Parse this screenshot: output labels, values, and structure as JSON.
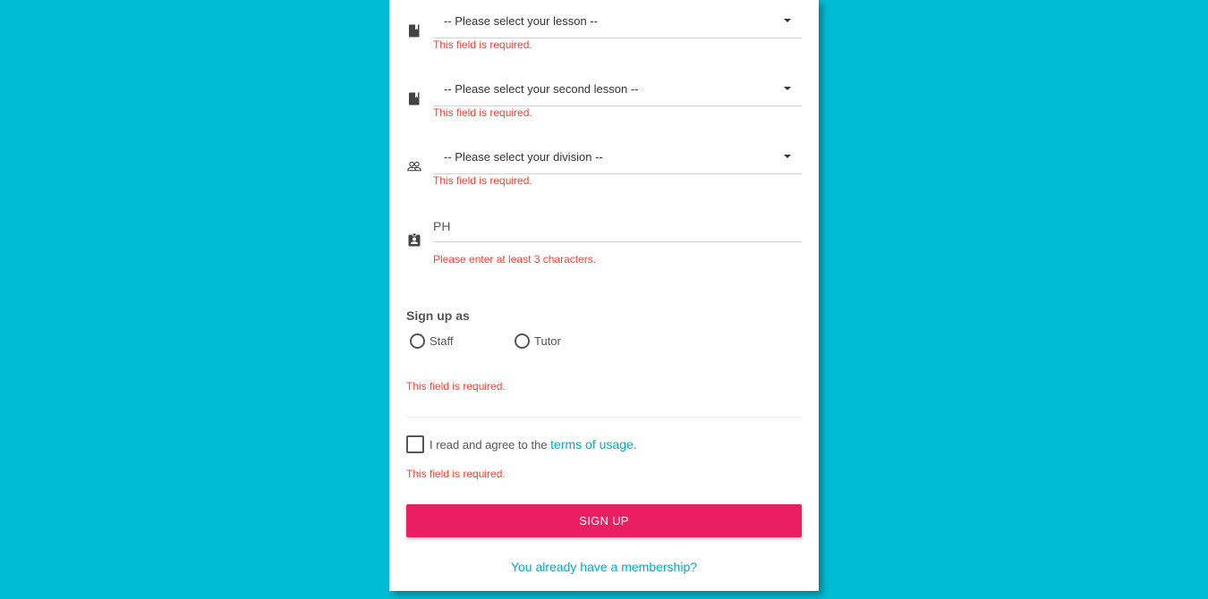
{
  "form": {
    "lesson": {
      "icon": "book-icon",
      "value": "-- Please select your lesson --",
      "error": "This field is required."
    },
    "second_lesson": {
      "icon": "book-icon",
      "value": "-- Please select your second lesson --",
      "error": "This field is required."
    },
    "division": {
      "icon": "group-icon",
      "value": "-- Please select your division --",
      "error": "This field is required."
    },
    "id_field": {
      "icon": "badge-icon",
      "value": "PH",
      "error": "Please enter at least 3 characters."
    },
    "signup_as": {
      "title": "Sign up as",
      "options": [
        "Staff",
        "Tutor"
      ],
      "error": "This field is required."
    },
    "terms": {
      "text": "I read and agree to the",
      "link": "terms of usage.",
      "error": "This field is required."
    },
    "submit_label": "SIGN UP",
    "membership_link": "You already have a membership?"
  },
  "colors": {
    "background": "#00bcd4",
    "button": "#e91e63",
    "error": "#f44336",
    "link": "#00acc1"
  }
}
